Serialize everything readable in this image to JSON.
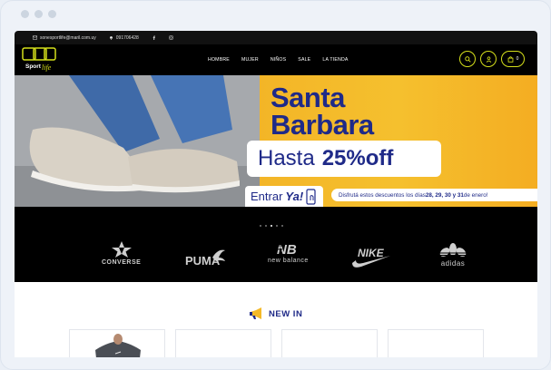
{
  "topbar": {
    "email": "sonesportlife@maril.com.uy",
    "phone": "091706428"
  },
  "brand_logo": {
    "text": "Sport",
    "script": "life"
  },
  "nav": {
    "items": [
      "HOMBRE",
      "MUJER",
      "NIÑOS",
      "SALE",
      "LA TIENDA"
    ],
    "cart_count": "0"
  },
  "hero": {
    "title_line1": "Santa",
    "title_line2": "Barbara",
    "hasta": "Hasta",
    "discount": "25%off",
    "entrar": "Entrar",
    "entrar_strong": "Ya!",
    "promo_text": "Disfrutá estos descuentos los días ",
    "promo_days": "28, 29, 30 y 31",
    "promo_end": " de enero!"
  },
  "brands": [
    "CONVERSE",
    "PUMA",
    "new balance",
    "NIKE",
    "adidas"
  ],
  "new_in": {
    "title": "NEW IN"
  },
  "colors": {
    "navy": "#1f2a88",
    "yellow": "#f4b928",
    "accent": "#d6e01b"
  }
}
